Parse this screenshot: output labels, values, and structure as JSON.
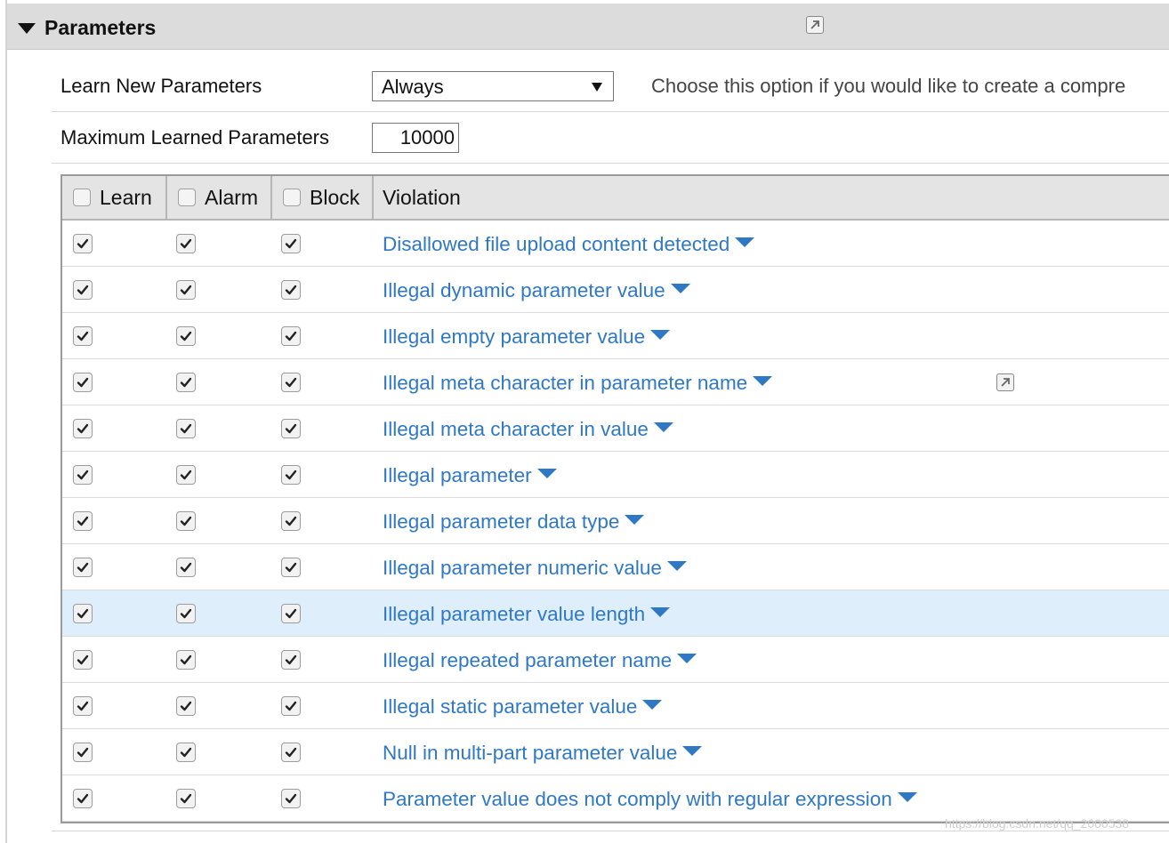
{
  "section": {
    "title": "Parameters",
    "collapse_icon": "caret-down-icon",
    "link_icon": "external-link-icon"
  },
  "learn_new": {
    "label": "Learn New Parameters",
    "value": "Always",
    "help": "Choose this option if you would like to create a compre"
  },
  "max_learned": {
    "label": "Maximum Learned Parameters",
    "value": "10000"
  },
  "table": {
    "headers": {
      "learn": "Learn",
      "alarm": "Alarm",
      "block": "Block",
      "violation": "Violation"
    },
    "rows": [
      {
        "violation": "Disallowed file upload content detected",
        "learn": true,
        "alarm": true,
        "block": true
      },
      {
        "violation": "Illegal dynamic parameter value",
        "learn": true,
        "alarm": true,
        "block": true
      },
      {
        "violation": "Illegal empty parameter value",
        "learn": true,
        "alarm": true,
        "block": true
      },
      {
        "violation": "Illegal meta character in parameter name",
        "learn": true,
        "alarm": true,
        "block": true,
        "has_link_icon": true
      },
      {
        "violation": "Illegal meta character in value",
        "learn": true,
        "alarm": true,
        "block": true
      },
      {
        "violation": "Illegal parameter",
        "learn": true,
        "alarm": true,
        "block": true
      },
      {
        "violation": "Illegal parameter data type",
        "learn": true,
        "alarm": true,
        "block": true
      },
      {
        "violation": "Illegal parameter numeric value",
        "learn": true,
        "alarm": true,
        "block": true
      },
      {
        "violation": "Illegal parameter value length",
        "learn": true,
        "alarm": true,
        "block": true,
        "highlighted": true
      },
      {
        "violation": "Illegal repeated parameter name",
        "learn": true,
        "alarm": true,
        "block": true
      },
      {
        "violation": "Illegal static parameter value",
        "learn": true,
        "alarm": true,
        "block": true
      },
      {
        "violation": "Null in multi-part parameter value",
        "learn": true,
        "alarm": true,
        "block": true
      },
      {
        "violation": "Parameter value does not comply with regular expression",
        "learn": true,
        "alarm": true,
        "block": true
      }
    ]
  },
  "watermark": "https://blog.csdn.net/qq_2000538",
  "colors": {
    "link": "#2f78c4",
    "highlight_row": "#dfeefb",
    "header_bg": "#dcdcdc"
  }
}
